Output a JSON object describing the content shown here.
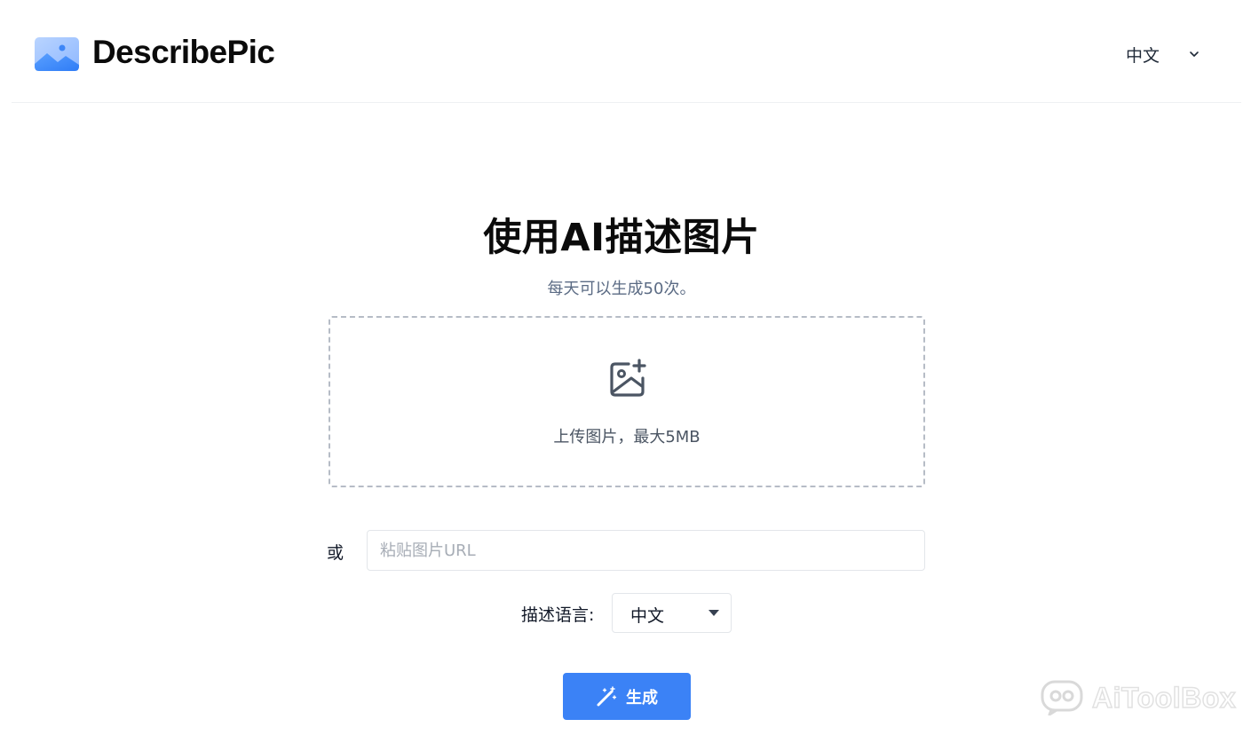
{
  "header": {
    "brand": "DescribePic",
    "logo_icon": "landscape-image-icon",
    "language_switch": {
      "label": "中文",
      "icon": "chevron-down-icon"
    }
  },
  "hero": {
    "title": "使用AI描述图片",
    "subtitle": "每天可以生成50次。"
  },
  "upload": {
    "icon": "image-plus-icon",
    "text": "上传图片，最大5MB"
  },
  "url": {
    "prefix": "或",
    "placeholder": "粘贴图片URL",
    "value": ""
  },
  "description_language": {
    "label": "描述语言:",
    "selected": "中文",
    "icon": "caret-down-icon"
  },
  "generate_button": {
    "label": "生成",
    "icon": "magic-wand-icon"
  },
  "watermark": {
    "text": "AiToolBox"
  },
  "colors": {
    "accent": "#3b82f6",
    "subtitle": "#5b6b84",
    "dashed_border": "#b6bcc6"
  }
}
